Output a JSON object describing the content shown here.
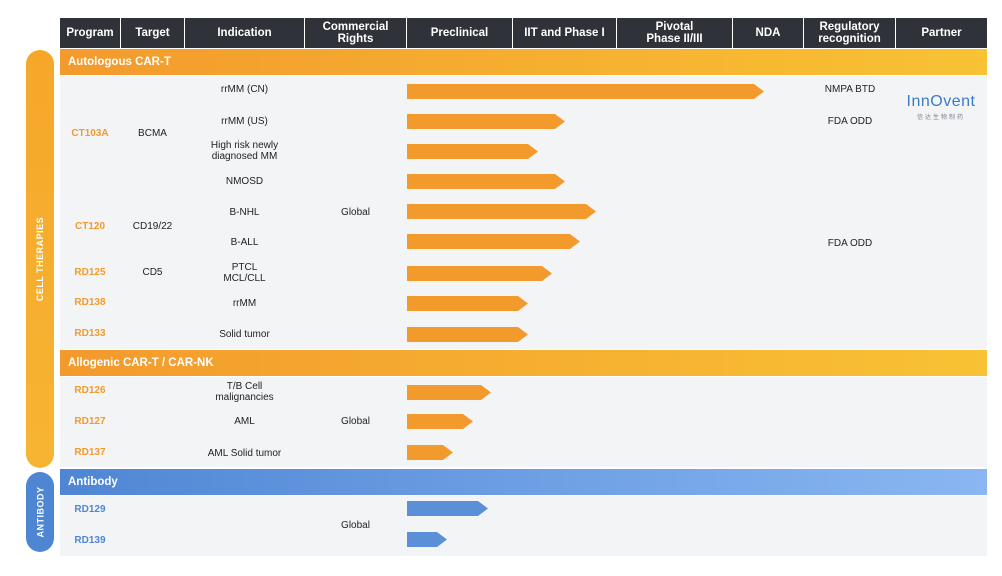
{
  "colors": {
    "header": "#2f3238",
    "accent": "#f39a2d",
    "band_orange": "#f6a72a",
    "antibody": "#5b8fd8",
    "row_bg": "#f3f4f6"
  },
  "headers": [
    "Program",
    "Target",
    "Indication",
    "Commercial Rights",
    "Preclinical",
    "IIT and Phase I",
    "Pivotal Phase II/III",
    "NDA",
    "Regulatory recognition",
    "Partner"
  ],
  "side_labels": {
    "cell": "CELL THERAPIES",
    "antibody": "ANTIBODY"
  },
  "sections": {
    "autologous": "Autologous CAR-T",
    "allogenic": "Allogenic CAR-T / CAR-NK",
    "antibody": "Antibody"
  },
  "programs": {
    "ct103a": "CT103A",
    "ct120": "CT120",
    "rd125": "RD125",
    "rd138": "RD138",
    "rd133": "RD133",
    "rd126": "RD126",
    "rd127": "RD127",
    "rd137": "RD137",
    "rd129": "RD129",
    "rd139": "RD139"
  },
  "targets": {
    "bcma": "BCMA",
    "cd1922": "CD19/22",
    "cd5": "CD5"
  },
  "indications": {
    "i1": "rrMM (CN)",
    "i2": "rrMM (US)",
    "i3": "High risk newly diagnosed MM",
    "i4": "NMOSD",
    "i5": "B-NHL",
    "i6": "B-ALL",
    "i7": "PTCL MCL/CLL",
    "i8": "rrMM",
    "i9": "Solid tumor",
    "i10": "T/B Cell malignancies",
    "i11": "AML",
    "i12": "AML Solid tumor"
  },
  "rights": {
    "r1": "Global",
    "r2": "Global",
    "r3": "Global"
  },
  "regulatory": {
    "g1": "NMPA BTD",
    "g2": "FDA ODD",
    "g3": "FDA ODD"
  },
  "partner": {
    "name": "InnOvent",
    "subtitle": "信达生物制药"
  },
  "chart_data": {
    "type": "bar",
    "stages": [
      "Preclinical",
      "IIT and Phase I",
      "Pivotal Phase II/III",
      "NDA"
    ],
    "progress_unit": "stage columns completed (0–4)",
    "rows": [
      {
        "program": "CT103A",
        "indication": "rrMM (CN)",
        "progress": 3.4
      },
      {
        "program": "CT103A",
        "indication": "rrMM (US)",
        "progress": 1.5
      },
      {
        "program": "CT103A",
        "indication": "High risk newly diagnosed MM",
        "progress": 1.25
      },
      {
        "program": "CT103A",
        "indication": "NMOSD",
        "progress": 1.5
      },
      {
        "program": "CT120",
        "indication": "B-NHL",
        "progress": 1.8
      },
      {
        "program": "CT120",
        "indication": "B-ALL",
        "progress": 1.65
      },
      {
        "program": "RD125",
        "indication": "PTCL MCL/CLL",
        "progress": 1.38
      },
      {
        "program": "RD138",
        "indication": "rrMM",
        "progress": 1.15
      },
      {
        "program": "RD133",
        "indication": "Solid tumor",
        "progress": 1.15
      },
      {
        "program": "RD126",
        "indication": "T/B Cell malignancies",
        "progress": 0.8
      },
      {
        "program": "RD127",
        "indication": "AML",
        "progress": 0.63
      },
      {
        "program": "RD137",
        "indication": "AML Solid tumor",
        "progress": 0.44
      },
      {
        "program": "RD129",
        "indication": "",
        "progress": 0.77
      },
      {
        "program": "RD139",
        "indication": "",
        "progress": 0.38
      }
    ]
  }
}
